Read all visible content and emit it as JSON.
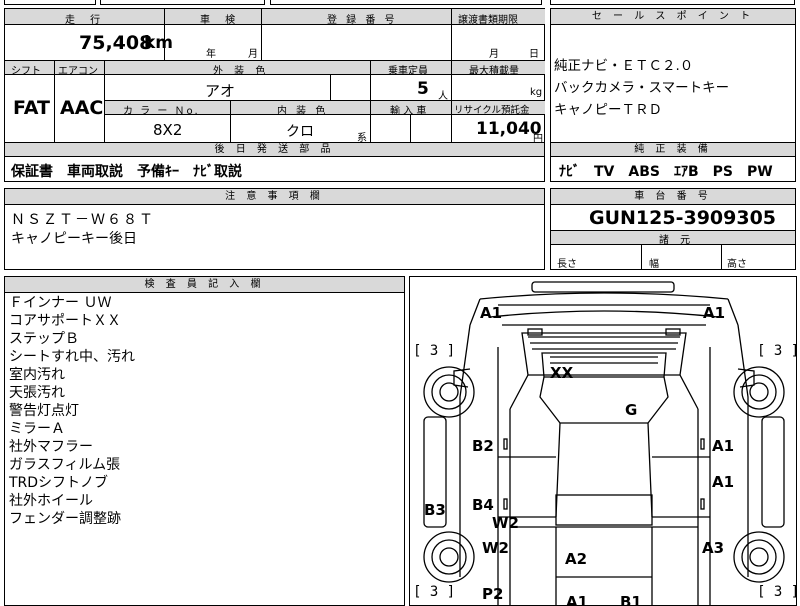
{
  "top_strip": [
    "",
    "",
    ""
  ],
  "spec": {
    "mileage_label": "走 行",
    "mileage_value": "75,408",
    "mileage_unit": "km",
    "inspection_label": "車 検",
    "inspection_year_unit": "年",
    "inspection_month_unit": "月",
    "registration_label": "登 録 番 号",
    "transfer_label": "譲渡書類期限",
    "transfer_month_unit": "月",
    "transfer_day_unit": "日",
    "shift_label": "シフト",
    "aircon_label": "エアコン",
    "exterior_color_label": "外 装 色",
    "capacity_label": "乗車定員",
    "max_load_label": "最大積載量",
    "shift_value": "FAT",
    "aircon_value": "AAC",
    "exterior_color_value": "アオ",
    "capacity_value": "5",
    "capacity_unit": "人",
    "load_unit": "kg",
    "color_no_label": "カ ラ ー Ｎo.",
    "interior_label": "内 装 色",
    "import_label": "輸 入 車",
    "recycle_label": "リサイクル預託金",
    "color_no_value": "8X2",
    "interior_value": "クロ",
    "interior_suffix": "系",
    "recycle_value": "11,040",
    "recycle_unit": "円",
    "parts_label": "後 日 発 送 部 品",
    "parts_value": "保証書　車両取説　予備ｷｰ　ﾅﾋﾞ取説"
  },
  "sales": {
    "label": "セ ー ル ス ポ イ ン ト",
    "lines": [
      "純正ナビ・ＥＴＣ２.０",
      "バックカメラ・スマートキー",
      "キャノピーＴＲＤ"
    ]
  },
  "equipment": {
    "label": "純 正 装 備",
    "value": "ﾅﾋﾞ　TV　ABS　ｴｱB　PS　PW"
  },
  "notes": {
    "label": "注 意 事 項 欄",
    "lines": [
      "ＮＳＺＴ－Ｗ６８Ｔ",
      "キャノピーキー後日"
    ]
  },
  "chassis": {
    "label": "車 台 番 号",
    "value": "GUN125-3909305",
    "dims_label": "諸 元",
    "length_label": "長さ",
    "width_label": "幅",
    "height_label": "高さ"
  },
  "inspector": {
    "label": "検 査 員 記 入 欄",
    "lines": [
      "Ｆインナー ＵＷ",
      "コアサポートＸＸ",
      "ステップＢ",
      "シートすれ中、汚れ",
      "室内汚れ",
      "天張汚れ",
      "警告灯点灯",
      "ミラーＡ",
      "社外マフラー",
      "ガラスフィルム張",
      "TRDシフトノブ",
      "社外ホイール",
      "フェンダー調整跡"
    ]
  },
  "diagram": {
    "marks": {
      "a1_left": "A1",
      "a1_right": "A1",
      "xx": "XX",
      "g": "G",
      "b2": "B2",
      "a1_door": "A1",
      "a1_rear": "A1",
      "b3": "B3",
      "b4": "B4",
      "w2_center": "W2",
      "w2_left": "W2",
      "a2": "A2",
      "a3": "A3",
      "p2": "P2",
      "a1_bed": "A1",
      "b1_bed": "B1"
    },
    "tire_tl": "[ 3 ]",
    "tire_tr": "[ 3 ]",
    "tire_bl": "[ 3 ]",
    "tire_br": "[ 3 ]"
  }
}
